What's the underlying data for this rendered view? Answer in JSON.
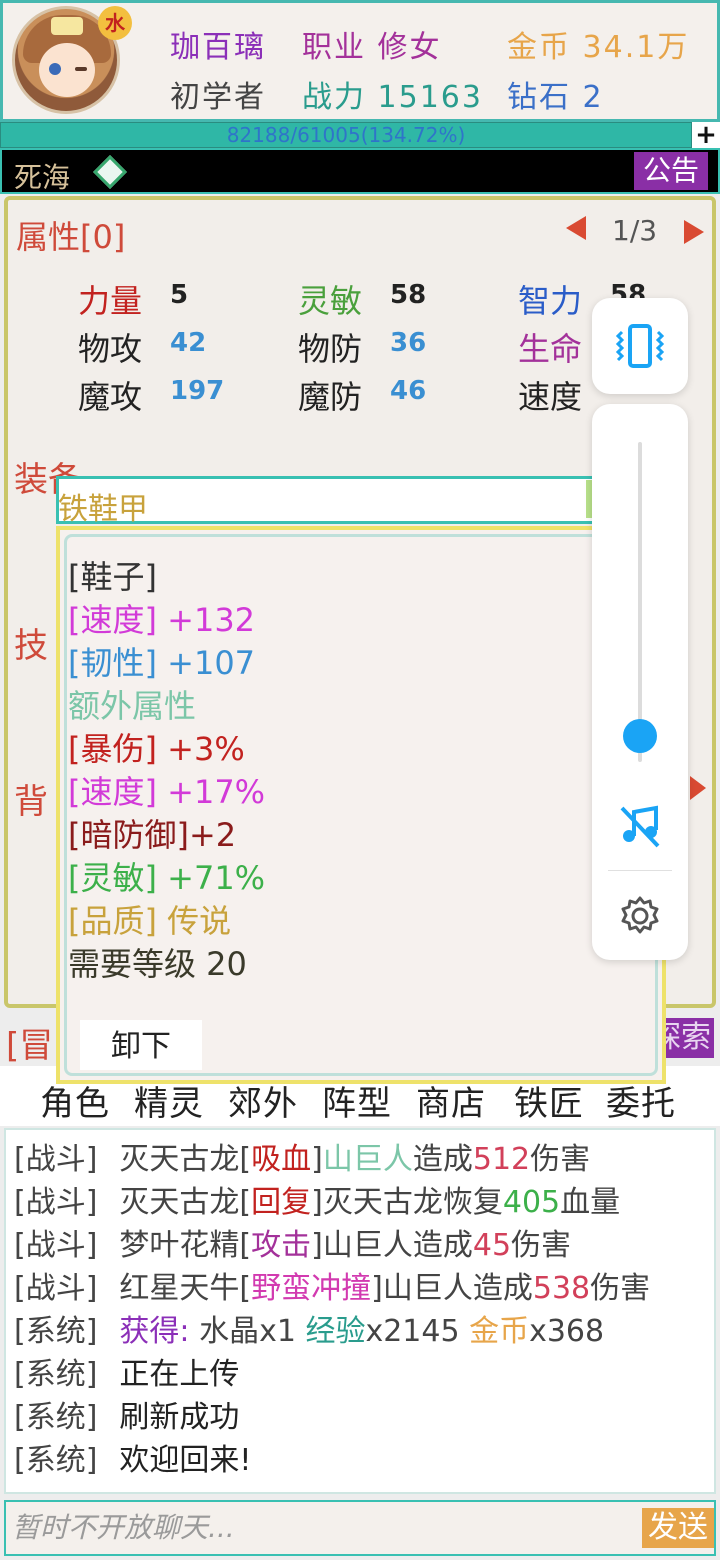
{
  "header": {
    "element_badge": "水",
    "player_name": "珈百璃",
    "job": "职业 修女",
    "gold": "金币 34.1万",
    "rank": "初学者",
    "power": "战力 15163",
    "diamond": "钻石 2",
    "exp_text": "82188/61005(134.72%)",
    "exp_progress": 1.0,
    "plus": "+"
  },
  "location": {
    "name": "死海",
    "notice": "公告"
  },
  "attributes": {
    "title": "属性[0]",
    "page": "1/3",
    "stats": [
      {
        "label": "力量",
        "value": "5",
        "label_color": "#c2221f"
      },
      {
        "label": "灵敏",
        "value": "58",
        "label_color": "#4aa03c"
      },
      {
        "label": "智力",
        "value": "58",
        "label_color": "#2a5cc8"
      },
      {
        "label": "物攻",
        "value": "42",
        "label_color": "#222222"
      },
      {
        "label": "物防",
        "value": "36",
        "label_color": "#222222"
      },
      {
        "label": "生命",
        "value": "",
        "label_color": "#a3319a"
      },
      {
        "label": "魔攻",
        "value": "197",
        "label_color": "#222222"
      },
      {
        "label": "魔防",
        "value": "46",
        "label_color": "#222222"
      },
      {
        "label": "速度",
        "value": "",
        "label_color": "#222222"
      }
    ],
    "equip_label": "装备",
    "skill_label": "技",
    "bag_label": "背"
  },
  "adventure": {
    "left_label": "[冒",
    "explore": "探索"
  },
  "nav": [
    "角色",
    "精灵",
    "郊外",
    "阵型",
    "商店",
    "铁匠",
    "委托"
  ],
  "log": [
    {
      "tag": "[战斗]",
      "parts": [
        {
          "t": "灭天古龙",
          "c": "#444444"
        },
        {
          "t": "[",
          "c": "#444444"
        },
        {
          "t": "吸血",
          "c": "#c2221f"
        },
        {
          "t": "]",
          "c": "#444444"
        },
        {
          "t": "山巨人",
          "c": "#7cc6a8"
        },
        {
          "t": "造成",
          "c": "#444444"
        },
        {
          "t": "512",
          "c": "#d2405a"
        },
        {
          "t": "伤害",
          "c": "#444444"
        }
      ]
    },
    {
      "tag": "[战斗]",
      "parts": [
        {
          "t": "灭天古龙",
          "c": "#444444"
        },
        {
          "t": "[",
          "c": "#444444"
        },
        {
          "t": "回复",
          "c": "#c2221f"
        },
        {
          "t": "]",
          "c": "#444444"
        },
        {
          "t": "灭天古龙恢复",
          "c": "#444444"
        },
        {
          "t": "405",
          "c": "#3cb04a"
        },
        {
          "t": "血量",
          "c": "#444444"
        }
      ]
    },
    {
      "tag": "[战斗]",
      "parts": [
        {
          "t": "梦叶花精",
          "c": "#444444"
        },
        {
          "t": "[",
          "c": "#444444"
        },
        {
          "t": "攻击",
          "c": "#a3319a"
        },
        {
          "t": "]",
          "c": "#444444"
        },
        {
          "t": "山巨人造成",
          "c": "#444444"
        },
        {
          "t": "45",
          "c": "#d2405a"
        },
        {
          "t": "伤害",
          "c": "#444444"
        }
      ]
    },
    {
      "tag": "[战斗]",
      "parts": [
        {
          "t": "红星天牛",
          "c": "#444444"
        },
        {
          "t": "[",
          "c": "#444444"
        },
        {
          "t": "野蛮冲撞",
          "c": "#d23ab0"
        },
        {
          "t": "]",
          "c": "#444444"
        },
        {
          "t": "山巨人造成",
          "c": "#444444"
        },
        {
          "t": "538",
          "c": "#d2405a"
        },
        {
          "t": "伤害",
          "c": "#444444"
        }
      ]
    },
    {
      "tag": "[系统]",
      "parts": [
        {
          "t": "获得:",
          "c": "#8b2fb8"
        },
        {
          "t": " 水晶x1 ",
          "c": "#444444"
        },
        {
          "t": "经验",
          "c": "#2a9c8d"
        },
        {
          "t": "x2145 ",
          "c": "#444444"
        },
        {
          "t": "金币",
          "c": "#e7a54a"
        },
        {
          "t": "x368",
          "c": "#444444"
        }
      ]
    },
    {
      "tag": "[系统]",
      "parts": [
        {
          "t": "正在上传",
          "c": "#222222"
        }
      ]
    },
    {
      "tag": "[系统]",
      "parts": [
        {
          "t": "刷新成功",
          "c": "#222222"
        }
      ]
    },
    {
      "tag": "[系统]",
      "parts": [
        {
          "t": "欢迎回来!",
          "c": "#222222"
        }
      ]
    }
  ],
  "chat": {
    "placeholder": "暂时不开放聊天...",
    "send": "发送"
  },
  "item": {
    "name": "铁鞋甲",
    "lines": [
      {
        "text": "[鞋子]",
        "color": "#333333"
      },
      {
        "text": "[速度] +132",
        "color": "#d23ad8"
      },
      {
        "text": "[韧性] +107",
        "color": "#3a8fd2"
      },
      {
        "text": "额外属性",
        "color": "#7cc6a8"
      },
      {
        "text": "[暴伤] +3%",
        "color": "#c2221f"
      },
      {
        "text": "[速度] +17%",
        "color": "#d23ad8"
      },
      {
        "text": "[暗防御]+2",
        "color": "#8a1b1b"
      },
      {
        "text": "[灵敏] +71%",
        "color": "#3cb04a"
      },
      {
        "text": "[品质] 传说",
        "color": "#c8a23c"
      },
      {
        "text": "需要等级 20",
        "color": "#3a3a2a"
      }
    ],
    "unequip": "卸下"
  },
  "overlay": {
    "volume_level": 0.08
  }
}
